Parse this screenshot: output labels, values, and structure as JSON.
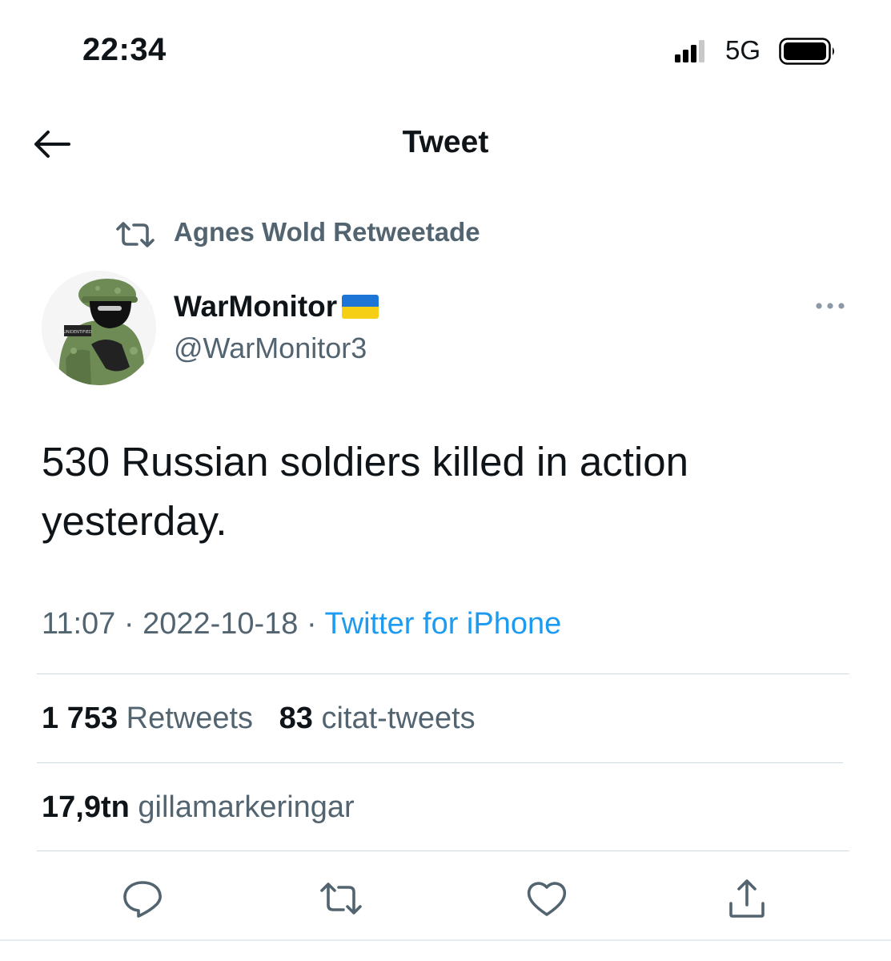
{
  "status_bar": {
    "time": "22:34",
    "network": "5G"
  },
  "header": {
    "title": "Tweet",
    "back_icon": "arrow-left-icon"
  },
  "retweet_context": {
    "icon": "retweet-icon",
    "text": "Agnes Wold Retweetade"
  },
  "author": {
    "name": "WarMonitor",
    "handle": "@WarMonitor3",
    "flag": "ukraine-flag",
    "avatar_text": "UNIDENTIFIED ARMY"
  },
  "tweet": {
    "text": "530 Russian soldiers killed in action yesterday.",
    "time": "11:07",
    "separator": "·",
    "date": "2022-10-18",
    "source": "Twitter for iPhone"
  },
  "stats": {
    "retweets_count": "1 753",
    "retweets_label": "Retweets",
    "quotes_count": "83",
    "quotes_label": "citat-tweets",
    "likes_count": "17,9tn",
    "likes_label": "gillamarkeringar"
  },
  "actions": [
    "reply-icon",
    "retweet-icon",
    "like-icon",
    "share-icon"
  ],
  "colors": {
    "text": "#0f1419",
    "secondary": "#536471",
    "link": "#1d9bf0",
    "divider": "#cfd9de"
  }
}
